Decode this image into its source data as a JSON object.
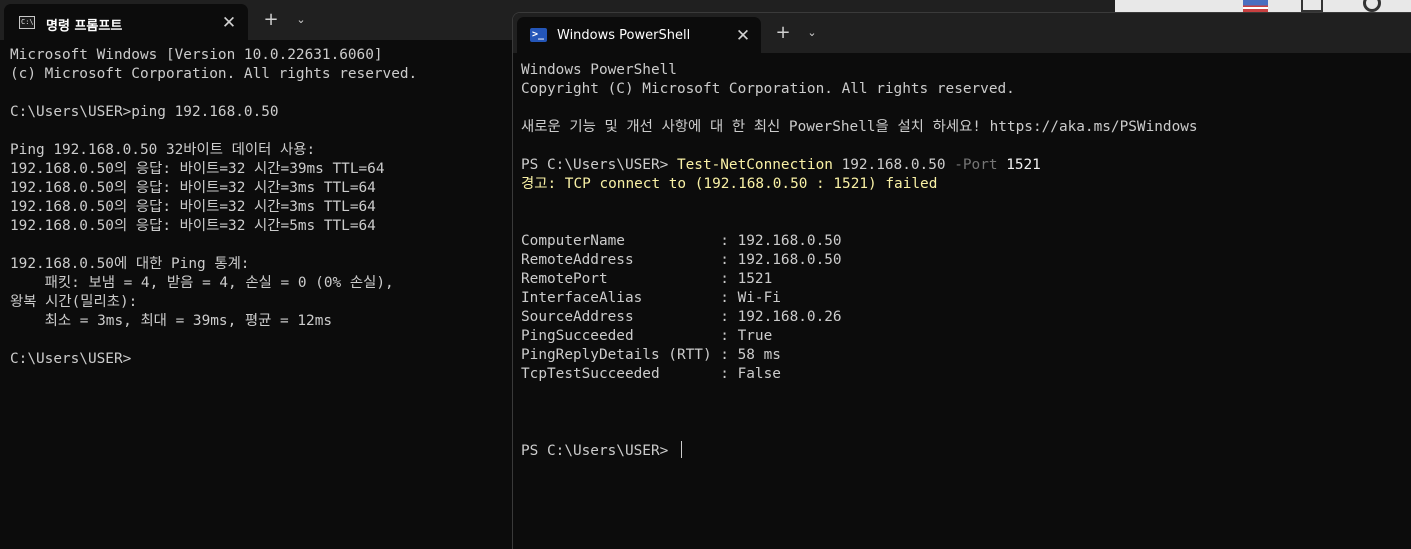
{
  "cmd": {
    "tab_title": "명령 프롬프트",
    "tab_icon": "cmd-icon",
    "close_glyph": "✕",
    "new_tab_glyph": "+",
    "dropdown_glyph": "⌄",
    "lines": [
      "Microsoft Windows [Version 10.0.22631.6060]",
      "(c) Microsoft Corporation. All rights reserved.",
      "",
      "C:\\Users\\USER>ping 192.168.0.50",
      "",
      "Ping 192.168.0.50 32바이트 데이터 사용:",
      "192.168.0.50의 응답: 바이트=32 시간=39ms TTL=64",
      "192.168.0.50의 응답: 바이트=32 시간=3ms TTL=64",
      "192.168.0.50의 응답: 바이트=32 시간=3ms TTL=64",
      "192.168.0.50의 응답: 바이트=32 시간=5ms TTL=64",
      "",
      "192.168.0.50에 대한 Ping 통계:",
      "    패킷: 보냄 = 4, 받음 = 4, 손실 = 0 (0% 손실),",
      "왕복 시간(밀리초):",
      "    최소 = 3ms, 최대 = 39ms, 평균 = 12ms",
      "",
      "C:\\Users\\USER>"
    ]
  },
  "powershell": {
    "tab_title": "Windows PowerShell",
    "tab_icon": "powershell-icon",
    "close_glyph": "✕",
    "new_tab_glyph": "+",
    "dropdown_glyph": "⌄",
    "banner": [
      "Windows PowerShell",
      "Copyright (C) Microsoft Corporation. All rights reserved.",
      "",
      "새로운 기능 및 개선 사항에 대 한 최신 PowerShell을 설치 하세요! https://aka.ms/PSWindows",
      ""
    ],
    "command": {
      "prompt": "PS C:\\Users\\USER> ",
      "cmdlet": "Test-NetConnection",
      "arg": " 192.168.0.50 ",
      "param": "-Port",
      "param_value": " 1521"
    },
    "warning": "경고: TCP connect to (192.168.0.50 : 1521) failed",
    "results": [
      {
        "key": "ComputerName",
        "value": "192.168.0.50"
      },
      {
        "key": "RemoteAddress",
        "value": "192.168.0.50"
      },
      {
        "key": "RemotePort",
        "value": "1521"
      },
      {
        "key": "InterfaceAlias",
        "value": "Wi-Fi"
      },
      {
        "key": "SourceAddress",
        "value": "192.168.0.26"
      },
      {
        "key": "PingSucceeded",
        "value": "True"
      },
      {
        "key": "PingReplyDetails (RTT)",
        "value": "58 ms"
      },
      {
        "key": "TcpTestSucceeded",
        "value": "False"
      }
    ],
    "final_prompt": "PS C:\\Users\\USER> "
  },
  "colors": {
    "terminal_bg": "#0c0c0c",
    "titlebar_bg": "#202020",
    "text": "#cccccc",
    "cmdlet_yellow": "#f9f1a5",
    "param_gray": "#767676",
    "powershell_blue": "#2456b8"
  }
}
